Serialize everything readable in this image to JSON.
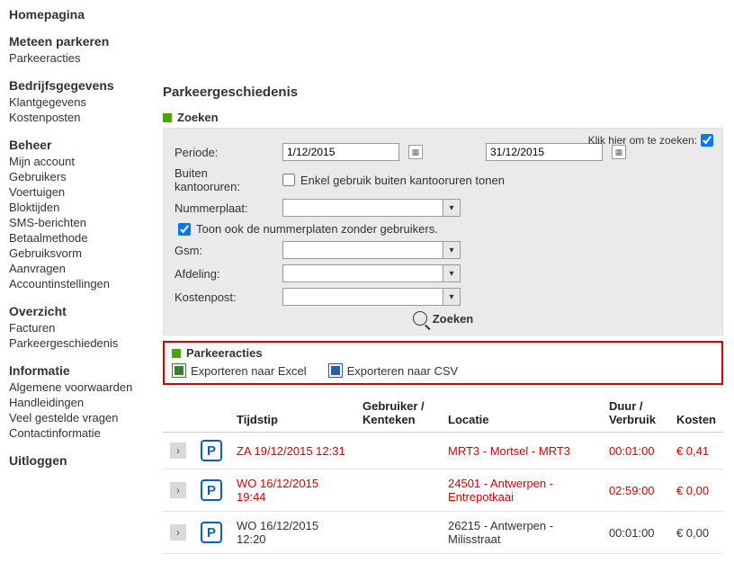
{
  "sidebar": {
    "groups": [
      {
        "title": "Homepagina",
        "items": []
      },
      {
        "title": "Meteen parkeren",
        "items": [
          "Parkeeracties"
        ]
      },
      {
        "title": "Bedrijfsgegevens",
        "items": [
          "Klantgegevens",
          "Kostenposten"
        ]
      },
      {
        "title": "Beheer",
        "items": [
          "Mijn account",
          "Gebruikers",
          "Voertuigen",
          "Bloktijden",
          "SMS-berichten",
          "Betaalmethode",
          "Gebruiksvorm",
          "Aanvragen",
          "Accountinstellingen"
        ]
      },
      {
        "title": "Overzicht",
        "items": [
          "Facturen",
          "Parkeergeschiedenis"
        ]
      },
      {
        "title": "Informatie",
        "items": [
          "Algemene voorwaarden",
          "Handleidingen",
          "Veel gestelde vragen",
          "Contactinformatie"
        ]
      },
      {
        "title": "Uitloggen",
        "items": []
      }
    ]
  },
  "page": {
    "title": "Parkeergeschiedenis"
  },
  "search": {
    "section_title": "Zoeken",
    "click_hint": "Klik hier om te zoeken:",
    "labels": {
      "periode": "Periode:",
      "buiten": "Buiten kantooruren:",
      "buiten_cb": "Enkel gebruik buiten kantooruren tonen",
      "nummerplaat": "Nummerplaat:",
      "toon_ook": "Toon ook de nummerplaten zonder gebruikers.",
      "gsm": "Gsm:",
      "afdeling": "Afdeling:",
      "kostenpost": "Kostenpost:"
    },
    "values": {
      "date_from": "1/12/2015",
      "date_to": "31/12/2015",
      "buiten_checked": false,
      "toon_ook_checked": true,
      "nummerplaat": "",
      "gsm": "",
      "afdeling": "",
      "kostenpost": ""
    },
    "button": "Zoeken"
  },
  "results": {
    "section_title": "Parkeeracties",
    "export_excel": "Exporteren naar Excel",
    "export_csv": "Exporteren naar CSV",
    "headers": {
      "tijdstip": "Tijdstip",
      "gebruiker": "Gebruiker / Kenteken",
      "locatie": "Locatie",
      "duur": "Duur / Verbruik",
      "kosten": "Kosten"
    },
    "rows": [
      {
        "tijdstip": "ZA 19/12/2015 12:31",
        "gebruiker": "",
        "locatie": "MRT3 - Mortsel - MRT3",
        "duur": "00:01:00",
        "kosten": "€ 0,41",
        "highlight": true
      },
      {
        "tijdstip": "WO 16/12/2015 19:44",
        "gebruiker": "",
        "locatie": "24501 - Antwerpen - Entrepotkaai",
        "duur": "02:59:00",
        "kosten": "€ 0,00",
        "highlight": true
      },
      {
        "tijdstip": "WO 16/12/2015 12:20",
        "gebruiker": "",
        "locatie": "26215 - Antwerpen - Milisstraat",
        "duur": "00:01:00",
        "kosten": "€ 0,00",
        "highlight": false
      }
    ]
  }
}
